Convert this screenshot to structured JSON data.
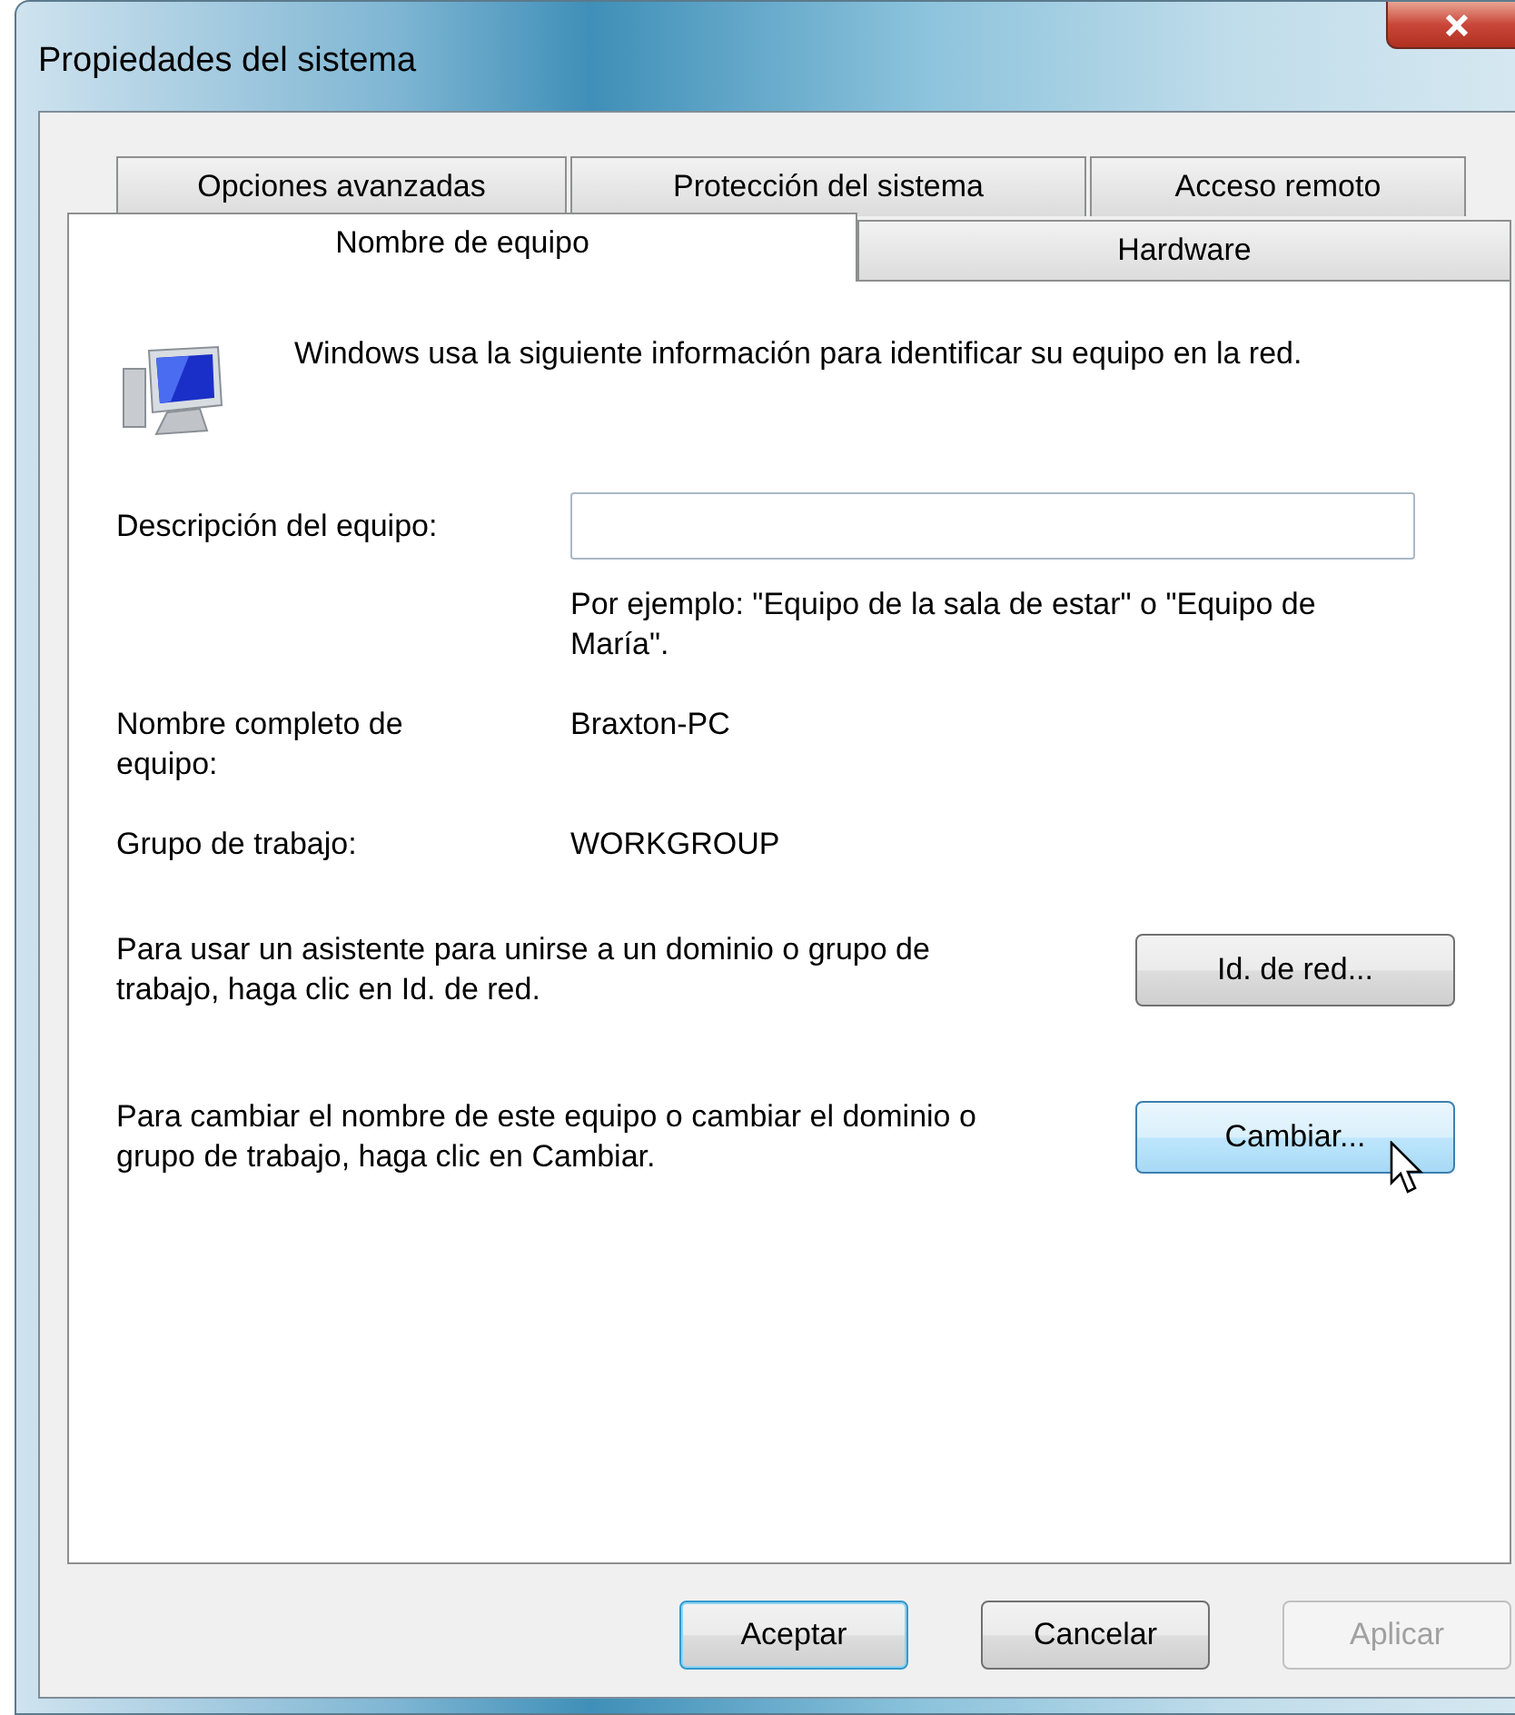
{
  "window": {
    "title": "Propiedades del sistema"
  },
  "tab_rows": [
    [
      {
        "label": "Opciones avanzadas",
        "selected": false
      },
      {
        "label": "Protección del sistema",
        "selected": false
      },
      {
        "label": "Acceso remoto",
        "selected": false
      }
    ],
    [
      {
        "label": "Nombre de equipo",
        "selected": true
      },
      {
        "label": "Hardware",
        "selected": false
      }
    ]
  ],
  "intro": "Windows usa la siguiente información para identificar su equipo en la red.",
  "description": {
    "label": "Descripción del equipo:",
    "hint": "Por ejemplo: \"Equipo de la sala de estar\" o \"Equipo de María\"."
  },
  "info": [
    {
      "label": "Nombre completo de equipo:",
      "value": "Braxton-PC"
    },
    {
      "label": "Grupo de trabajo:",
      "value": "WORKGROUP"
    }
  ],
  "actions": [
    {
      "text": "Para usar un asistente para unirse a un dominio o grupo de trabajo, haga clic en Id. de red.",
      "button": "Id. de red...",
      "hovered": false
    },
    {
      "text": "Para cambiar el nombre de este equipo o cambiar el dominio o grupo de trabajo, haga clic en Cambiar.",
      "button": "Cambiar...",
      "hovered": true
    }
  ],
  "buttons": [
    {
      "label": "Aceptar",
      "default": true,
      "disabled": false
    },
    {
      "label": "Cancelar",
      "default": false,
      "disabled": false
    },
    {
      "label": "Aplicar",
      "default": false,
      "disabled": true
    }
  ]
}
